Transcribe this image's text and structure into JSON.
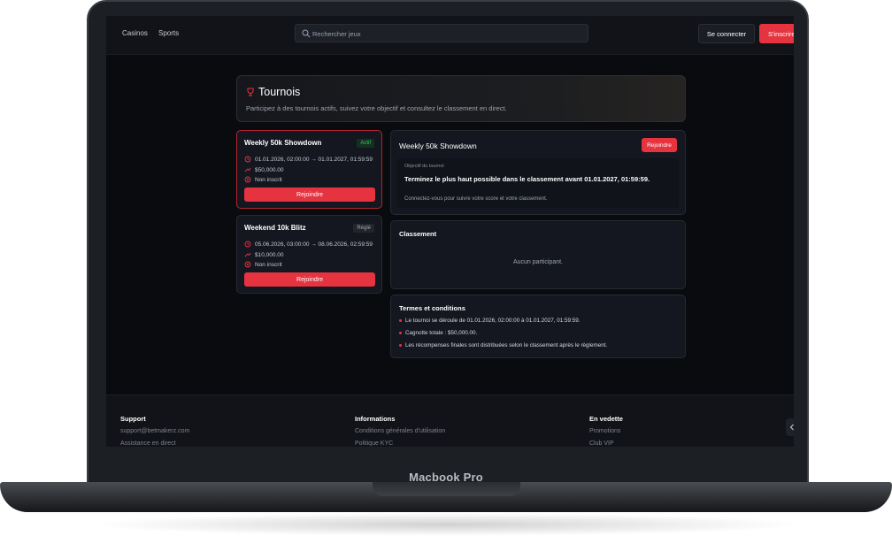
{
  "device": {
    "label": "Macbook Pro"
  },
  "topbar": {
    "nav": [
      {
        "label": "Casinos"
      },
      {
        "label": "Sports"
      }
    ],
    "search_placeholder": "Rechercher  jeux",
    "login_label": "Se connecter",
    "signup_label": "S'inscrire"
  },
  "header": {
    "title": "Tournois",
    "subtitle": "Participez à des tournois actifs, suivez votre objectif et consultez le classement en direct."
  },
  "tournaments": [
    {
      "name": "Weekly 50k Showdown",
      "status": "Actif",
      "dates": "01.01.2026, 02:00:00 → 01.01.2027, 01:59:59",
      "prize": "$50,000.00",
      "registration": "Non inscrit",
      "join_label": "Rejoindre"
    },
    {
      "name": "Weekend 10k Blitz",
      "status": "Réglé",
      "dates": "05.06.2026, 03:00:00 → 08.06.2026, 02:59:59",
      "prize": "$10,000.00",
      "registration": "Non inscrit",
      "join_label": "Rejoindre"
    }
  ],
  "detail": {
    "title": "Weekly 50k Showdown",
    "join_label": "Rejoindre",
    "objective_label": "Objectif du tournoi",
    "objective_text": "Terminez le plus haut possible dans le classement avant 01.01.2027, 01:59:59.",
    "connect_note": "Connectez-vous pour suivre votre score et votre classement."
  },
  "leaderboard": {
    "title": "Classement",
    "empty_text": "Aucun participant."
  },
  "terms": {
    "title": "Termes et conditions",
    "items": [
      "Le tournoi se déroule de 01.01.2026, 02:00:00 à 01.01.2027, 01:59:59.",
      "Cagnotte totale : $50,000.00.",
      "Les récompenses finales sont distribuées selon le classement après le règlement."
    ]
  },
  "footer": {
    "columns": [
      {
        "title": "Support",
        "links": [
          "support@betmakerz.com",
          "Assistance en direct"
        ]
      },
      {
        "title": "Informations",
        "links": [
          "Conditions générales d'utilisation",
          "Politique KYC"
        ]
      },
      {
        "title": "En vedette",
        "links": [
          "Promotions",
          "Club VIP"
        ]
      }
    ]
  },
  "colors": {
    "accent": "#e5333f",
    "background": "#0a0b0e",
    "card": "#141720",
    "active_badge": "#39c26a"
  },
  "icons": {
    "search": "search-icon",
    "trophy": "trophy-icon",
    "clock": "clock-icon",
    "prize": "prize-icon",
    "status": "status-icon"
  }
}
